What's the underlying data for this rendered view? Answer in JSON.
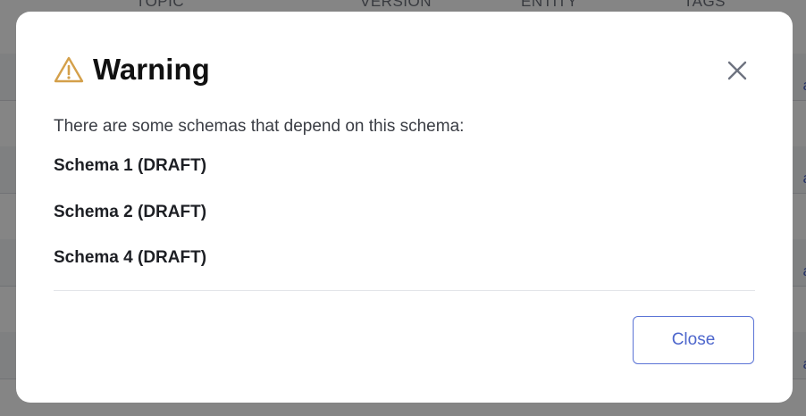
{
  "background": {
    "columns": [
      "TOPIC",
      "VERSION",
      "ENTITY",
      "TAGS"
    ],
    "row_links": [
      "a",
      "a",
      "a",
      "a"
    ]
  },
  "modal": {
    "title": "Warning",
    "icon": "warning-triangle-icon",
    "message": "There are some schemas that depend on this schema:",
    "schemas": [
      "Schema 1 (DRAFT)",
      "Schema 2 (DRAFT)",
      "Schema 4 (DRAFT)"
    ],
    "close_button_label": "Close",
    "close_icon": "close-icon"
  },
  "colors": {
    "warning_icon": "#d4a04a",
    "accent": "#4d66cc",
    "overlay": "rgba(0,0,0,0.48)"
  }
}
